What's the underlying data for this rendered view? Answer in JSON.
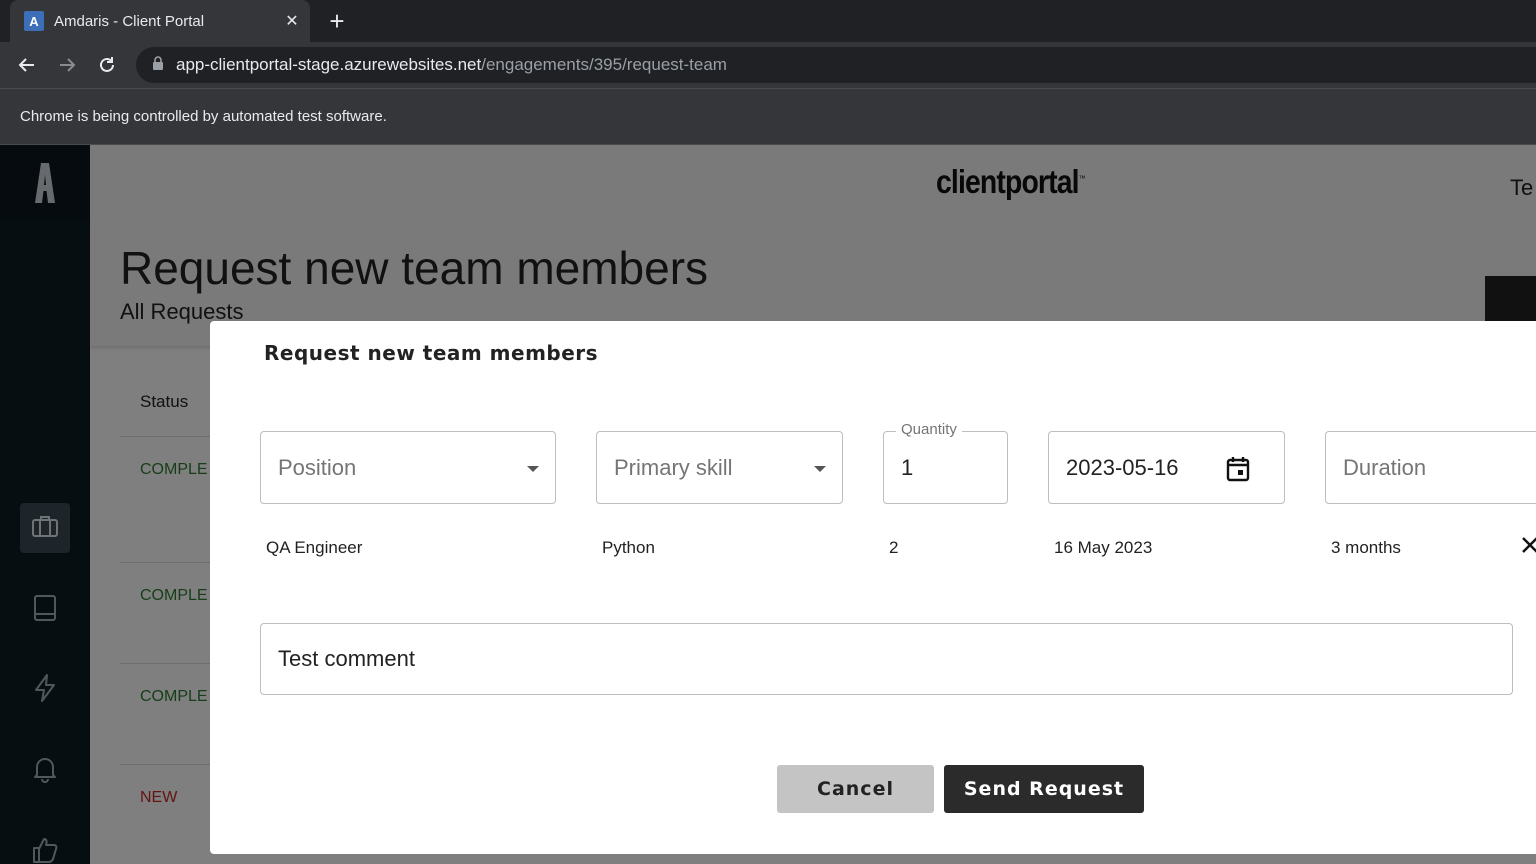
{
  "browser": {
    "tab_title": "Amdaris - Client Portal",
    "favicon_letter": "A",
    "url_host": "app-clientportal-stage.azurewebsites.net",
    "url_path": "/engagements/395/request-team",
    "infobar": "Chrome is being controlled by automated test software."
  },
  "header": {
    "brand": "clientportal",
    "brand_tm": "™",
    "right_text": "Te"
  },
  "page": {
    "title": "Request new team members",
    "subtitle": "All Requests"
  },
  "table": {
    "status_header": "Status",
    "rows": [
      {
        "status": "COMPLE"
      },
      {
        "status": "COMPLE"
      },
      {
        "status": "COMPLE"
      },
      {
        "status": "NEW"
      }
    ]
  },
  "sidebar": {
    "items": [
      "briefcase-icon",
      "book-icon",
      "lightning-icon",
      "bell-icon",
      "thumbs-up-icon"
    ]
  },
  "modal": {
    "title": "Request new team members",
    "fields": {
      "position_placeholder": "Position",
      "primary_skill_placeholder": "Primary skill",
      "quantity_label": "Quantity",
      "quantity_value": "1",
      "start_date_value": "2023-05-16",
      "duration_placeholder": "Duration"
    },
    "request_row": {
      "position": "QA Engineer",
      "skill": "Python",
      "quantity": "2",
      "start_date": "16 May 2023",
      "duration": "3 months"
    },
    "comment": "Test comment",
    "cancel_label": "Cancel",
    "send_label": "Send Request"
  },
  "colors": {
    "completed": "#2e7d32",
    "new": "#c62828",
    "sidebar": "#0f1c24"
  }
}
